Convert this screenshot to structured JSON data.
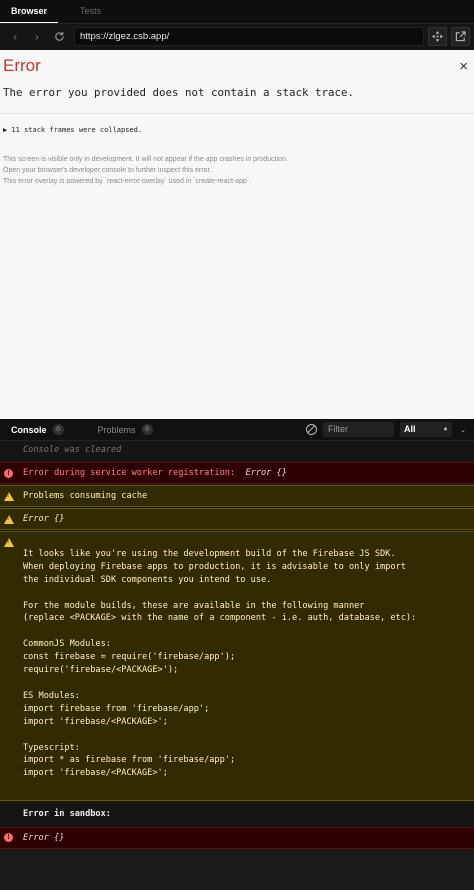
{
  "tabs": {
    "browser": "Browser",
    "tests": "Tests"
  },
  "address": {
    "url": "https://zlgez.csb.app/"
  },
  "preview": {
    "error_title": "Error",
    "close_glyph": "×",
    "message": "The error you provided does not contain a stack trace.",
    "frames_toggle": "▶ 11 stack frames were collapsed.",
    "notes": [
      "This screen is visible only in development. It will not appear if the app crashes in production.",
      "Open your browser's developer console to further inspect this error.",
      "This error overlay is powered by `react-error-overlay` used in `create-react-app`."
    ]
  },
  "console": {
    "tabs": {
      "console_label": "Console",
      "console_count": "0",
      "problems_label": "Problems",
      "problems_count": "0"
    },
    "filter_placeholder": "Filter",
    "level": "All",
    "entries": {
      "cleared": "Console was cleared",
      "sw_error_prefix": "Error during service worker registration:",
      "sw_error_value": "Error {}",
      "warn_cache": "Problems consuming cache",
      "warn_obj": "Error {}",
      "warn_firebase": "\nIt looks like you're using the development build of the Firebase JS SDK.\nWhen deploying Firebase apps to production, it is advisable to only import\nthe individual SDK components you intend to use.\n\nFor the module builds, these are available in the following manner\n(replace <PACKAGE> with the name of a component - i.e. auth, database, etc):\n\nCommonJS Modules:\nconst firebase = require('firebase/app');\nrequire('firebase/<PACKAGE>');\n\nES Modules:\nimport firebase from 'firebase/app';\nimport 'firebase/<PACKAGE>';\n\nTypescript:\nimport * as firebase from 'firebase/app';\nimport 'firebase/<PACKAGE>';\n",
      "sandbox_log": "Error in sandbox:",
      "sandbox_error": "Error {}"
    }
  },
  "colors": {
    "error_red": "#c93630",
    "warn_bg": "#332b00",
    "error_bg": "#2f0000"
  }
}
